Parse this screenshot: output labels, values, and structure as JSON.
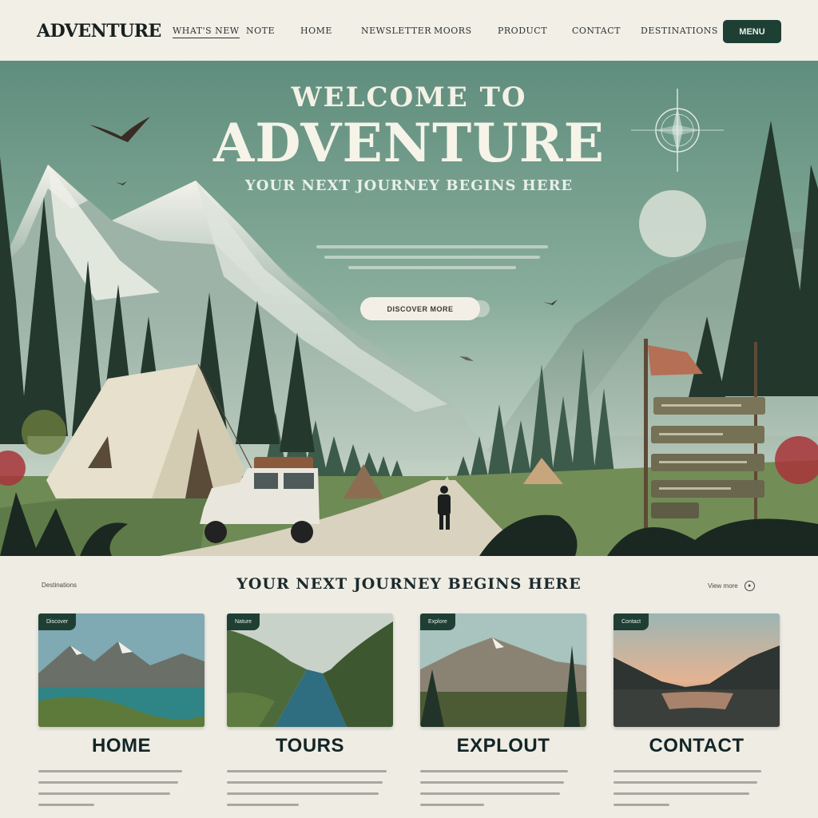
{
  "nav": {
    "logo": "ADVENTURE",
    "links": [
      "WHAT'S NEW",
      "NOTE",
      "HOME",
      "NEWSLETTER",
      "MOORS",
      "PRODUCT",
      "CONTACT",
      "DESTINATIONS"
    ],
    "button": "MENU"
  },
  "hero": {
    "title_line1": "WELCOME TO",
    "title_line2": "ADVENTURE",
    "subtitle": "YOUR NEXT JOURNEY BEGINS HERE",
    "cta": "DISCOVER MORE",
    "icons": [
      "compass-icon",
      "moon-icon",
      "bird-icon",
      "signpost-icon",
      "flag-icon"
    ]
  },
  "section": {
    "label": "Destinations",
    "title": "YOUR NEXT JOURNEY BEGINS HERE",
    "more": "View more"
  },
  "cards": [
    {
      "tag": "Discover",
      "title": "HOME"
    },
    {
      "tag": "Nature",
      "title": "TOURS"
    },
    {
      "tag": "Explore",
      "title": "EXPLOUT"
    },
    {
      "tag": "Contact",
      "title": "CONTACT"
    }
  ],
  "colors": {
    "accent": "#1d3f34",
    "hero_sky": "#7ea694",
    "background": "#efece4"
  }
}
